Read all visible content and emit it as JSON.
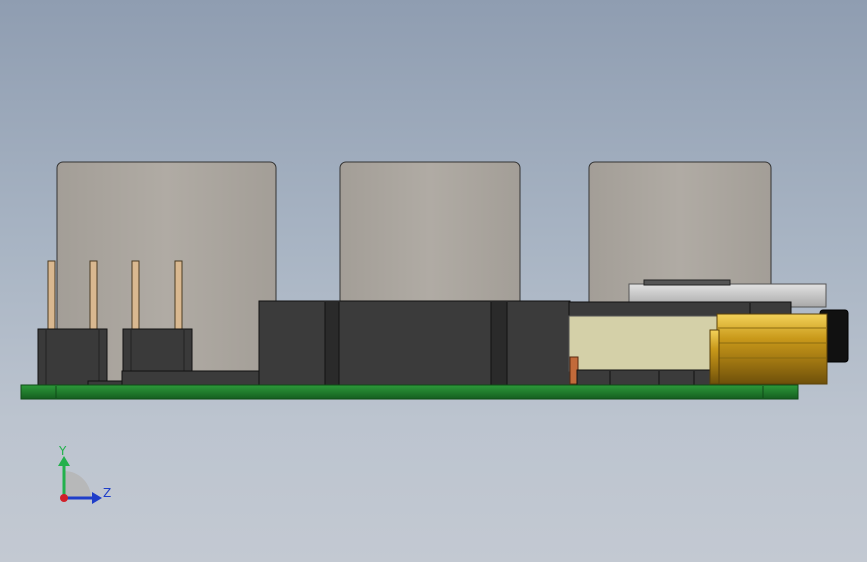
{
  "viewport": {
    "background_top": "#8f9db1",
    "background_bottom": "#c3c9d2"
  },
  "colors": {
    "pcb": "#1f7a2c",
    "pcb_edge": "#0f4a17",
    "housing": "#aaa59e",
    "housing_edge": "#3a3a3a",
    "connector": "#3a3a3a",
    "pin": "#d9b890",
    "ffc": "#d4d0a8",
    "brass": "#c79a1c",
    "metal": "#c9c9c9"
  },
  "triad": {
    "y_label": "Y",
    "z_label": "Z",
    "y_color": "#22b14c",
    "z_color": "#1f3ec9",
    "x_color": "#d0202a"
  }
}
